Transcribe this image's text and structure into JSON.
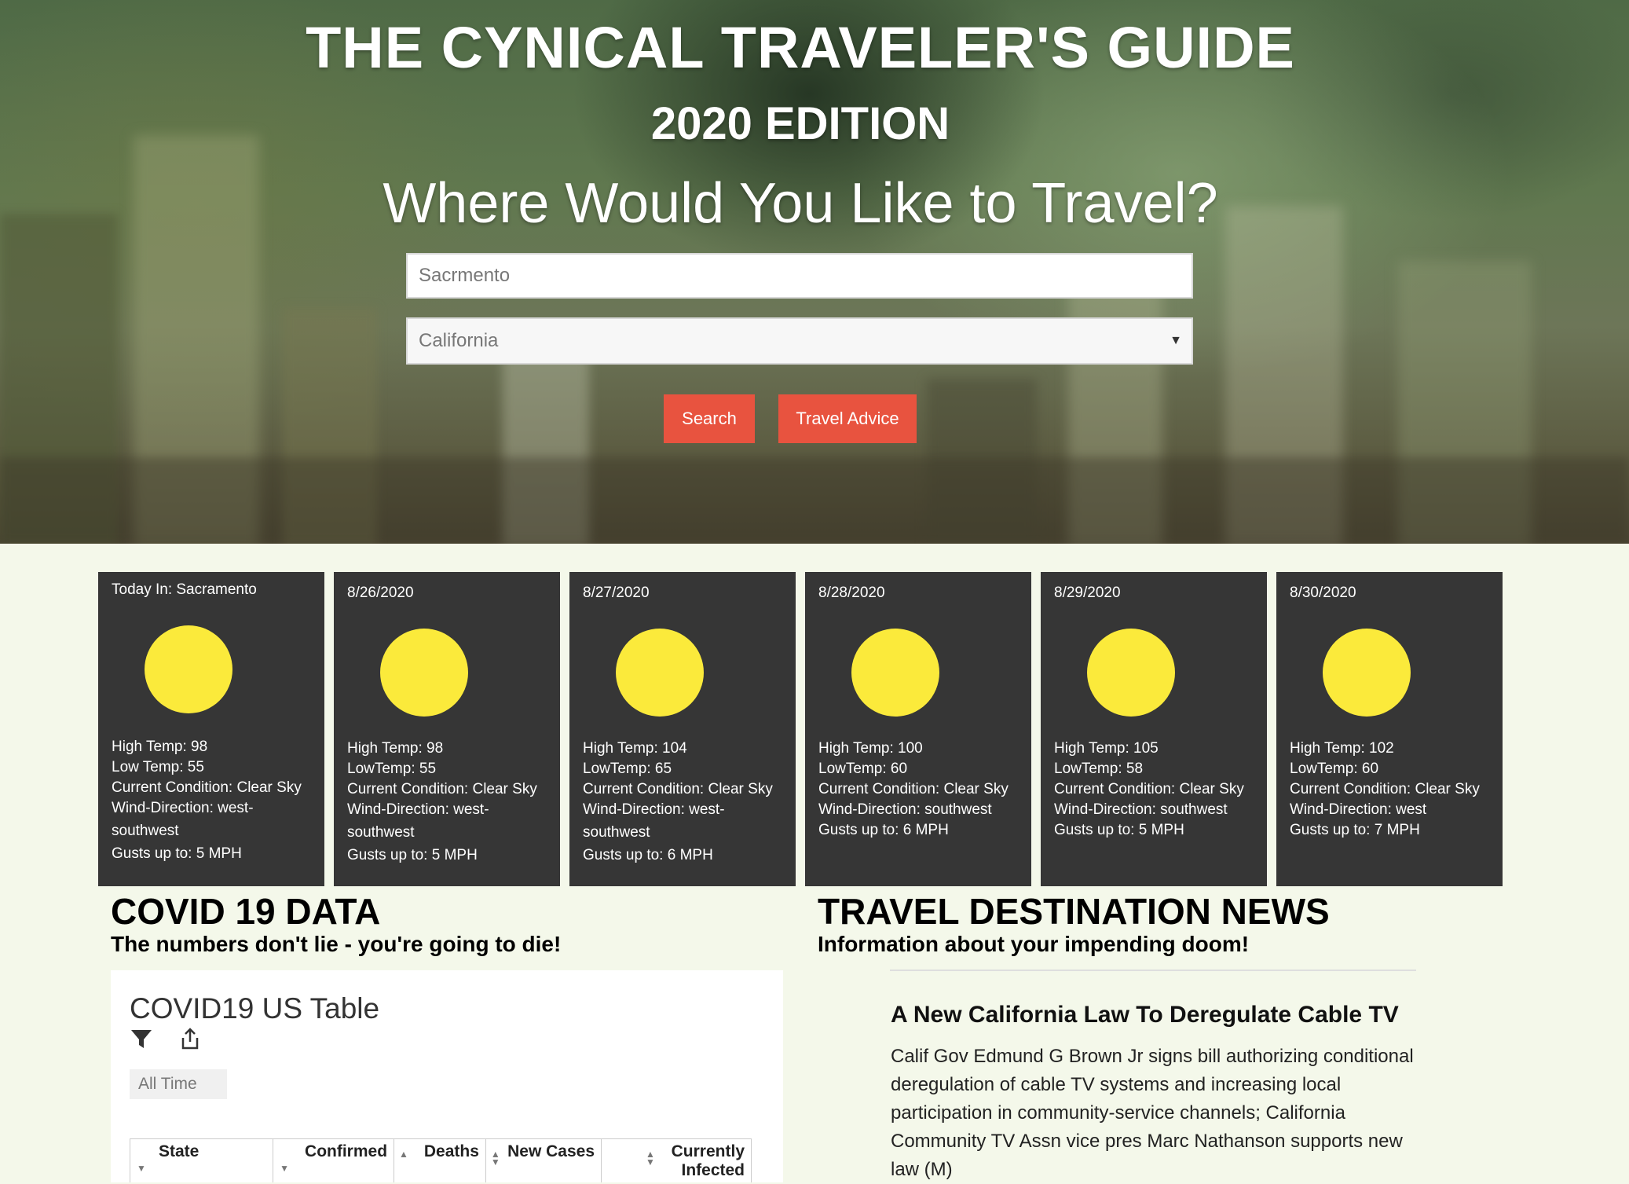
{
  "header": {
    "title": "THE CYNICAL TRAVELER'S GUIDE",
    "edition": "2020 EDITION",
    "question": "Where Would You Like to Travel?"
  },
  "search": {
    "city_placeholder": "Sacrmento",
    "state_selected": "California",
    "search_label": "Search",
    "advice_label": "Travel Advice"
  },
  "colors": {
    "button": "#e8533f",
    "card_bg": "#363636",
    "sun": "#fbea3b",
    "page_bg": "#f4f8ea"
  },
  "weather": [
    {
      "date": "Today In: Sacramento",
      "icon": "sun-icon",
      "lines": [
        "High Temp: 98",
        "Low Temp: 55",
        "Current Condition: Clear Sky",
        "Wind-Direction: west-",
        "southwest",
        "Gusts up to: 5 MPH"
      ]
    },
    {
      "date": "8/26/2020",
      "icon": "sun-icon",
      "lines": [
        "High Temp: 98",
        "LowTemp: 55",
        "Current Condition: Clear Sky",
        "Wind-Direction: west-",
        "southwest",
        "Gusts up to: 5 MPH"
      ]
    },
    {
      "date": "8/27/2020",
      "icon": "sun-icon",
      "lines": [
        "High Temp: 104",
        "LowTemp: 65",
        "Current Condition: Clear Sky",
        "Wind-Direction: west-",
        "southwest",
        "Gusts up to: 6 MPH"
      ]
    },
    {
      "date": "8/28/2020",
      "icon": "sun-icon",
      "lines": [
        "High Temp: 100",
        "LowTemp: 60",
        "Current Condition: Clear Sky",
        "Wind-Direction: southwest",
        "Gusts up to: 6 MPH"
      ]
    },
    {
      "date": "8/29/2020",
      "icon": "sun-icon",
      "lines": [
        "High Temp: 105",
        "LowTemp: 58",
        "Current Condition: Clear Sky",
        "Wind-Direction: southwest",
        "Gusts up to: 5 MPH"
      ]
    },
    {
      "date": "8/30/2020",
      "icon": "sun-icon",
      "lines": [
        "High Temp: 102",
        "LowTemp: 60",
        "Current Condition: Clear Sky",
        "Wind-Direction: west",
        "Gusts up to: 7 MPH"
      ]
    }
  ],
  "covid": {
    "title": "COVID 19 DATA",
    "subtitle": "The numbers don't lie - you're going to die!",
    "table_title": "COVID19 US Table",
    "range_label": "All Time",
    "columns": [
      "State",
      "Confirmed",
      "Deaths",
      "New Cases",
      "Currently Infected"
    ]
  },
  "news": {
    "title": "TRAVEL DESTINATION NEWS",
    "subtitle": "Information about your impending doom!",
    "headline": "A New California Law To Deregulate Cable TV",
    "body": "Calif Gov Edmund G Brown Jr signs bill authorizing conditional deregulation of cable TV systems and increasing local participation in community-service channels; California Community TV Assn vice pres Marc Nathanson supports new law (M)"
  }
}
